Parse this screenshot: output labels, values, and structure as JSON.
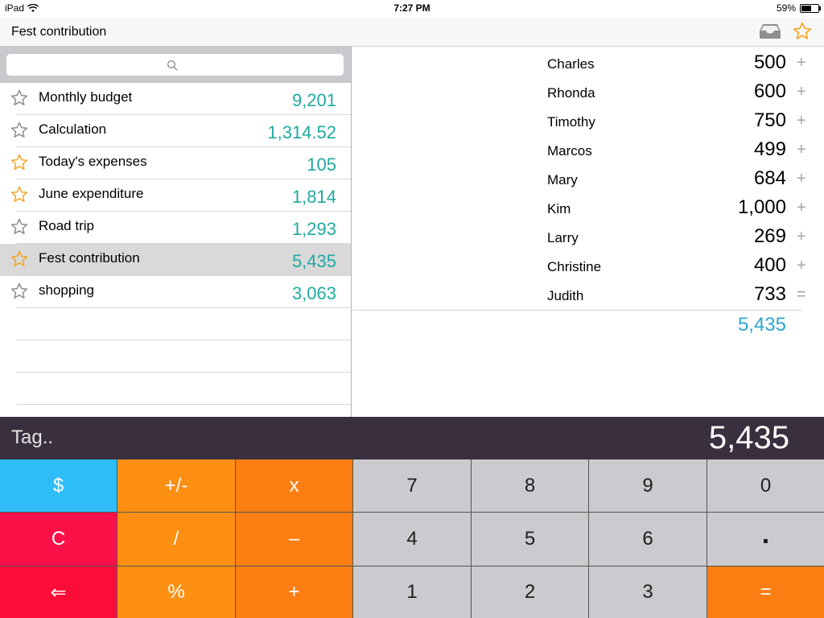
{
  "status_bar": {
    "device": "iPad",
    "time": "7:27 PM",
    "battery": "59%",
    "battery_level": 0.59
  },
  "nav": {
    "title": "Fest contribution"
  },
  "sheets": [
    {
      "name": "Monthly budget",
      "value": "9,201",
      "favorite": false
    },
    {
      "name": "Calculation",
      "value": "1,314.52",
      "favorite": false
    },
    {
      "name": "Today's expenses",
      "value": "105",
      "favorite": true
    },
    {
      "name": "June expenditure",
      "value": "1,814",
      "favorite": true
    },
    {
      "name": "Road trip",
      "value": "1,293",
      "favorite": false
    },
    {
      "name": "Fest contribution",
      "value": "5,435",
      "favorite": true,
      "selected": true
    },
    {
      "name": "shopping",
      "value": "3,063",
      "favorite": false
    }
  ],
  "entries": [
    {
      "name": "Charles",
      "value": "500",
      "op": "+"
    },
    {
      "name": "Rhonda",
      "value": "600",
      "op": "+"
    },
    {
      "name": "Timothy",
      "value": "750",
      "op": "+"
    },
    {
      "name": "Marcos",
      "value": "499",
      "op": "+"
    },
    {
      "name": "Mary",
      "value": "684",
      "op": "+"
    },
    {
      "name": "Kim",
      "value": "1,000",
      "op": "+"
    },
    {
      "name": "Larry",
      "value": "269",
      "op": "+"
    },
    {
      "name": "Christine",
      "value": "400",
      "op": "+"
    },
    {
      "name": "Judith",
      "value": "733",
      "op": "="
    }
  ],
  "total": "5,435",
  "display": {
    "tag": "Tag..",
    "value": "5,435"
  },
  "keys": [
    [
      {
        "label": "$",
        "style": "k-blue",
        "name": "dollar-key"
      },
      {
        "label": "+/-",
        "style": "k-orange",
        "name": "sign-key"
      },
      {
        "label": "x",
        "style": "k-orange2",
        "name": "multiply-key"
      },
      {
        "label": "7",
        "style": "k-gray",
        "name": "key-7"
      },
      {
        "label": "8",
        "style": "k-gray",
        "name": "key-8"
      },
      {
        "label": "9",
        "style": "k-gray",
        "name": "key-9"
      },
      {
        "label": "0",
        "style": "k-gray",
        "name": "key-0"
      }
    ],
    [
      {
        "label": "C",
        "style": "k-red",
        "name": "clear-key"
      },
      {
        "label": "/",
        "style": "k-orange",
        "name": "divide-key"
      },
      {
        "label": "–",
        "style": "k-orange2",
        "name": "subtract-key"
      },
      {
        "label": "4",
        "style": "k-gray",
        "name": "key-4"
      },
      {
        "label": "5",
        "style": "k-gray",
        "name": "key-5"
      },
      {
        "label": "6",
        "style": "k-gray",
        "name": "key-6"
      },
      {
        "label": ".",
        "style": "k-gray",
        "name": "decimal-key"
      }
    ],
    [
      {
        "label": "⇐",
        "style": "k-red2",
        "name": "backspace-key"
      },
      {
        "label": "%",
        "style": "k-orange",
        "name": "percent-key"
      },
      {
        "label": "+",
        "style": "k-orange2",
        "name": "add-key"
      },
      {
        "label": "1",
        "style": "k-gray",
        "name": "key-1"
      },
      {
        "label": "2",
        "style": "k-gray",
        "name": "key-2"
      },
      {
        "label": "3",
        "style": "k-gray",
        "name": "key-3"
      },
      {
        "label": "=",
        "style": "k-orange2",
        "name": "equals-key"
      }
    ]
  ],
  "colors": {
    "accent_teal": "#1fa9a2",
    "total_blue": "#2aa8d2",
    "star_orange": "#f5a623",
    "display_bg": "#3a2f3f"
  }
}
